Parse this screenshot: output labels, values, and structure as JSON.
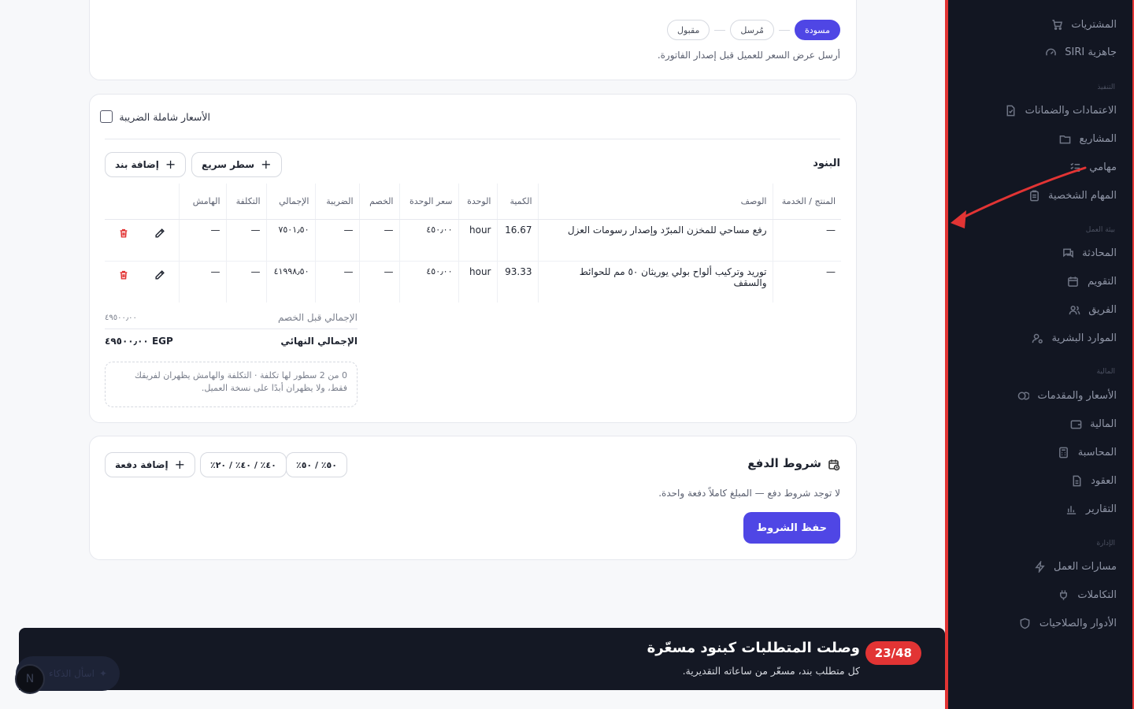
{
  "sidebar": {
    "items_top": [
      {
        "label": "المشتريات",
        "icon": "cart-icon"
      },
      {
        "label": "جاهزية SIRI",
        "icon": "gauge-icon"
      }
    ],
    "section_execution": "التنفيذ",
    "items_execution": [
      {
        "label": "الاعتمادات والضمانات",
        "icon": "file-check-icon"
      },
      {
        "label": "المشاريع",
        "icon": "folder-icon"
      },
      {
        "label": "مهامي",
        "icon": "tasks-icon"
      },
      {
        "label": "المهام الشخصية",
        "icon": "clipboard-icon"
      }
    ],
    "section_workspace": "بيئة العمل",
    "items_workspace": [
      {
        "label": "المحادثة",
        "icon": "chat-icon"
      },
      {
        "label": "التقويم",
        "icon": "calendar-icon"
      },
      {
        "label": "الفريق",
        "icon": "users-icon"
      },
      {
        "label": "الموارد البشرية",
        "icon": "user-gear-icon"
      }
    ],
    "section_finance": "المالية",
    "items_finance": [
      {
        "label": "الأسعار والمقدمات",
        "icon": "coins-icon"
      },
      {
        "label": "المالية",
        "icon": "wallet-icon"
      },
      {
        "label": "المحاسبة",
        "icon": "calculator-icon"
      },
      {
        "label": "العقود",
        "icon": "contract-icon"
      },
      {
        "label": "التقارير",
        "icon": "bar-chart-icon"
      }
    ],
    "section_admin": "الإدارة",
    "items_admin": [
      {
        "label": "مسارات العمل",
        "icon": "bolt-icon"
      },
      {
        "label": "التكاملات",
        "icon": "plug-icon"
      },
      {
        "label": "الأدوار والصلاحيات",
        "icon": "shield-icon"
      }
    ]
  },
  "status": {
    "steps": [
      "مسودة",
      "مُرسل",
      "مقبول"
    ],
    "active_step": "مسودة",
    "note": "أرسل عرض السعر للعميل قبل إصدار الفاتورة."
  },
  "items": {
    "tax_inclusive_label": "الأسعار شاملة الضريبة",
    "tax_inclusive_checked": false,
    "title": "البنود",
    "quick_line_label": "سطر سريع",
    "add_item_label": "إضافة بند",
    "columns": [
      "المنتج / الخدمة",
      "الوصف",
      "الكمية",
      "الوحدة",
      "سعر الوحدة",
      "الخصم",
      "الضريبة",
      "الإجمالي",
      "التكلفة",
      "الهامش"
    ],
    "rows": [
      {
        "product": "—",
        "description": "رفع مساحي للمخزن المبرّد وإصدار رسومات العزل",
        "qty": "16.67",
        "unit": "hour",
        "unit_price": "٤٥٠٫٠٠",
        "discount": "—",
        "tax": "—",
        "total": "٧٥٠١٫٥٠",
        "cost": "—",
        "margin": "—"
      },
      {
        "product": "—",
        "description": "توريد وتركيب ألواح بولي يوريثان ٥٠ مم للحوائط والسقف",
        "qty": "93.33",
        "unit": "hour",
        "unit_price": "٤٥٠٫٠٠",
        "discount": "—",
        "tax": "—",
        "total": "٤١٩٩٨٫٥٠",
        "cost": "—",
        "margin": "—"
      }
    ],
    "subtotal_label": "الإجمالي قبل الخصم",
    "subtotal_value": "٤٩٥٠٠٫٠٠",
    "grand_total_label": "الإجمالي النهائي",
    "grand_total_value": "EGP ٤٩٥٠٠٫٠٠",
    "cost_note": "0 من 2 سطور لها تكلفة · التكلفة والهامش يظهران لفريقك فقط، ولا يظهران أبدًا على نسخة العميل."
  },
  "payment": {
    "title": "شروط الدفع",
    "presets": [
      "٥٠٪ / ٥٠٪",
      "٤٠٪ / ٤٠٪ / ٢٠٪"
    ],
    "add_payment_label": "إضافة دفعة",
    "note": "لا توجد شروط دفع — المبلغ كاملاً دفعة واحدة.",
    "save_label": "حفظ الشروط"
  },
  "toast": {
    "badge": "23/48",
    "title": "وصلت المتطلبات كبنود مسعّرة",
    "subtitle": "كل متطلب بند، مسعّر من ساعاته التقديرية."
  },
  "chat": {
    "label": "اسأل الذكاء",
    "avatar": "N"
  },
  "colors": {
    "accent": "#4f46e5",
    "danger": "#e23434",
    "sidebar_bg": "#121622"
  }
}
